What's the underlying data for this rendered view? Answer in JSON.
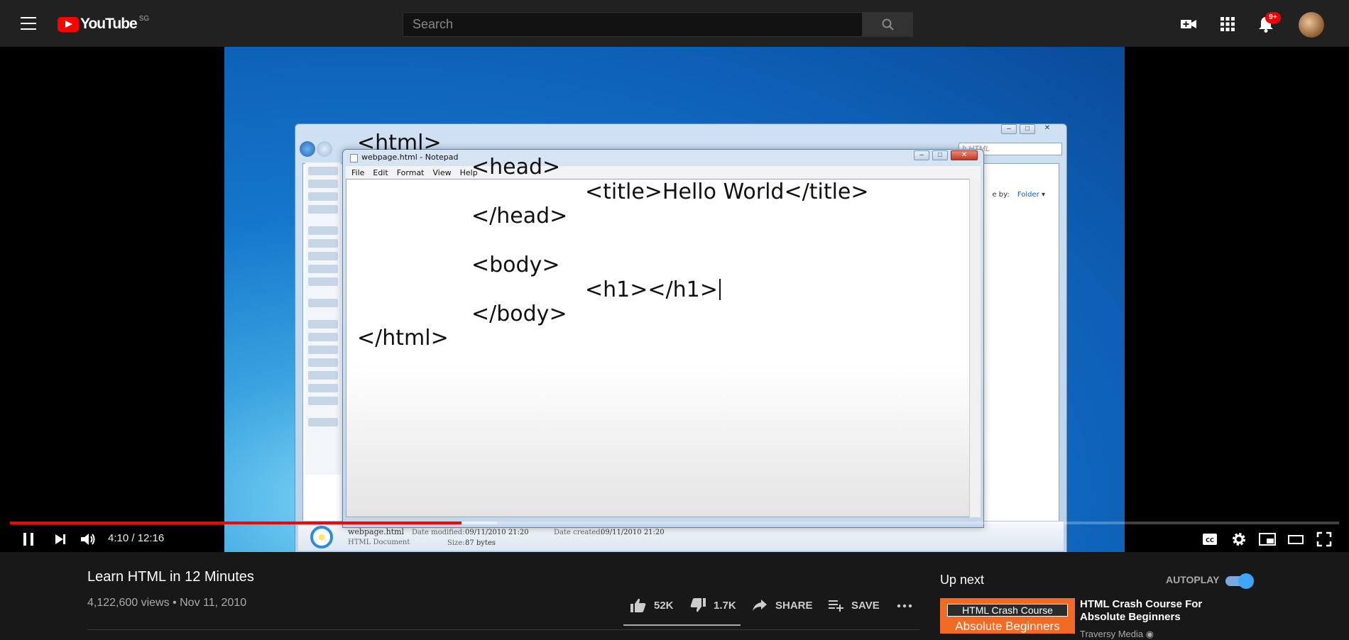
{
  "header": {
    "logo_text": "YouTube",
    "country_code": "SG",
    "search_placeholder": "Search",
    "notification_count": "9+"
  },
  "video_content": {
    "notepad_title": "webpage.html - Notepad",
    "notepad_menu": [
      "File",
      "Edit",
      "Format",
      "View",
      "Help"
    ],
    "code_lines": [
      "<html>",
      "<head>",
      "<title>Hello World</title>",
      "</head>",
      "<body>",
      "<h1></h1>",
      "</body>",
      "</html>"
    ],
    "explorer_search": "h HTML",
    "explorer_arrange_label": "e by:",
    "explorer_arrange_value": "Folder",
    "file_name": "webpage.html",
    "file_type": "HTML Document",
    "date_modified_label": "Date modified:",
    "date_modified": "09/11/2010 21:20",
    "date_created_label": "Date created:",
    "date_created": "09/11/2010 21:20",
    "size_label": "Size:",
    "size": "87 bytes"
  },
  "player": {
    "current_time": "4:10",
    "duration": "12:16",
    "time_display": "4:10 / 12:16",
    "progress_fraction": 0.34
  },
  "video": {
    "title": "Learn HTML in 12 Minutes",
    "meta": "4,122,600 views • Nov 11, 2010",
    "likes": "52K",
    "dislikes": "1.7K",
    "share_label": "SHARE",
    "save_label": "SAVE"
  },
  "sidebar": {
    "up_next_label": "Up next",
    "autoplay_label": "AUTOPLAY",
    "autoplay_on": true,
    "next_video": {
      "thumb_line1": "HTML Crash Course",
      "thumb_line2": "Absolute Beginners",
      "title": "HTML Crash Course For Absolute Beginners",
      "channel": "Traversy Media"
    }
  }
}
